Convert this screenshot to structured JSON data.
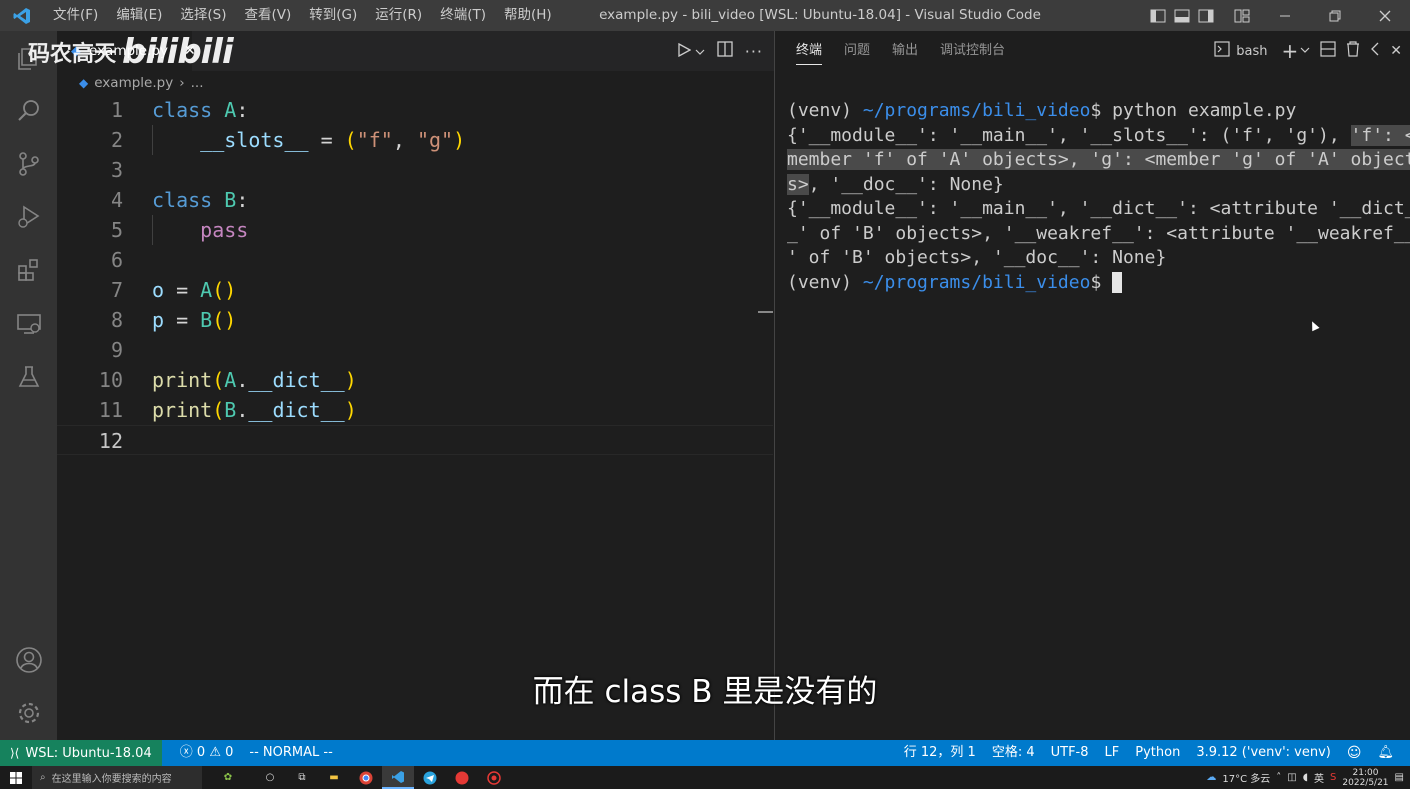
{
  "titlebar": {
    "menu": [
      "文件(F)",
      "编辑(E)",
      "选择(S)",
      "查看(V)",
      "转到(G)",
      "运行(R)",
      "终端(T)",
      "帮助(H)"
    ],
    "title": "example.py - bili_video [WSL: Ubuntu-18.04] - Visual Studio Code"
  },
  "watermark": {
    "author": "码农高天",
    "brand": "bilibili"
  },
  "editor": {
    "tab_label": "example.py",
    "breadcrumb_file": "example.py",
    "breadcrumb_rest": "...",
    "lines": [
      {
        "num": "1",
        "tokens": [
          {
            "t": "class",
            "c": "kw"
          },
          {
            "t": " ",
            "c": "pl"
          },
          {
            "t": "A",
            "c": "cls"
          },
          {
            "t": ":",
            "c": "pl"
          }
        ]
      },
      {
        "num": "2",
        "tokens": [
          {
            "t": "    ",
            "c": "pl"
          },
          {
            "t": "__slots__",
            "c": "var"
          },
          {
            "t": " = ",
            "c": "pl"
          },
          {
            "t": "(",
            "c": "br"
          },
          {
            "t": "\"f\"",
            "c": "str"
          },
          {
            "t": ", ",
            "c": "pl"
          },
          {
            "t": "\"g\"",
            "c": "str"
          },
          {
            "t": ")",
            "c": "br"
          }
        ]
      },
      {
        "num": "3",
        "tokens": []
      },
      {
        "num": "4",
        "tokens": [
          {
            "t": "class",
            "c": "kw"
          },
          {
            "t": " ",
            "c": "pl"
          },
          {
            "t": "B",
            "c": "cls"
          },
          {
            "t": ":",
            "c": "pl"
          }
        ]
      },
      {
        "num": "5",
        "tokens": [
          {
            "t": "    ",
            "c": "pl"
          },
          {
            "t": "pass",
            "c": "ctl"
          }
        ]
      },
      {
        "num": "6",
        "tokens": []
      },
      {
        "num": "7",
        "tokens": [
          {
            "t": "o",
            "c": "var"
          },
          {
            "t": " = ",
            "c": "pl"
          },
          {
            "t": "A",
            "c": "cls"
          },
          {
            "t": "()",
            "c": "br"
          }
        ]
      },
      {
        "num": "8",
        "tokens": [
          {
            "t": "p",
            "c": "var"
          },
          {
            "t": " = ",
            "c": "pl"
          },
          {
            "t": "B",
            "c": "cls"
          },
          {
            "t": "()",
            "c": "br"
          }
        ]
      },
      {
        "num": "9",
        "tokens": []
      },
      {
        "num": "10",
        "tokens": [
          {
            "t": "print",
            "c": "fn"
          },
          {
            "t": "(",
            "c": "br"
          },
          {
            "t": "A",
            "c": "cls"
          },
          {
            "t": ".",
            "c": "pl"
          },
          {
            "t": "__dict__",
            "c": "var"
          },
          {
            "t": ")",
            "c": "br"
          }
        ]
      },
      {
        "num": "11",
        "tokens": [
          {
            "t": "print",
            "c": "fn"
          },
          {
            "t": "(",
            "c": "br"
          },
          {
            "t": "B",
            "c": "cls"
          },
          {
            "t": ".",
            "c": "pl"
          },
          {
            "t": "__dict__",
            "c": "var"
          },
          {
            "t": ")",
            "c": "br"
          }
        ]
      },
      {
        "num": "12",
        "tokens": []
      }
    ]
  },
  "panel": {
    "tabs": [
      "终端",
      "问题",
      "输出",
      "调试控制台"
    ],
    "shell_label": "bash"
  },
  "terminal": {
    "prompt_venv": "(venv) ",
    "prompt_path": "~/programs/bili_video",
    "prompt_dollar": "$ ",
    "command": "python example.py",
    "out1a": "{'__module__': '__main__', '__slots__': ('f', 'g'), ",
    "out1b": "'f': <",
    "out2": "member 'f' of 'A' objects>, 'g': <member 'g' of 'A' object",
    "out3a": "s>",
    "out3b": ", '__doc__': None}",
    "out4": "{'__module__': '__main__', '__dict__': <attribute '__dict_",
    "out5": "_' of 'B' objects>, '__weakref__': <attribute '__weakref__",
    "out6": "' of 'B' objects>, '__doc__': None}"
  },
  "statusbar": {
    "remote": "WSL: Ubuntu-18.04",
    "errors": "0",
    "warnings": "0",
    "mode": "-- NORMAL --",
    "position": "行 12，列 1",
    "spaces": "空格: 4",
    "encoding": "UTF-8",
    "eol": "LF",
    "language": "Python",
    "interpreter": "3.9.12 ('venv': venv)"
  },
  "taskbar": {
    "search_placeholder": "在这里输入你要搜索的内容",
    "weather": "17°C 多云",
    "ime": "英",
    "time": "21:00",
    "date": "2022/5/21"
  },
  "subtitle": "而在 class B 里是没有的"
}
